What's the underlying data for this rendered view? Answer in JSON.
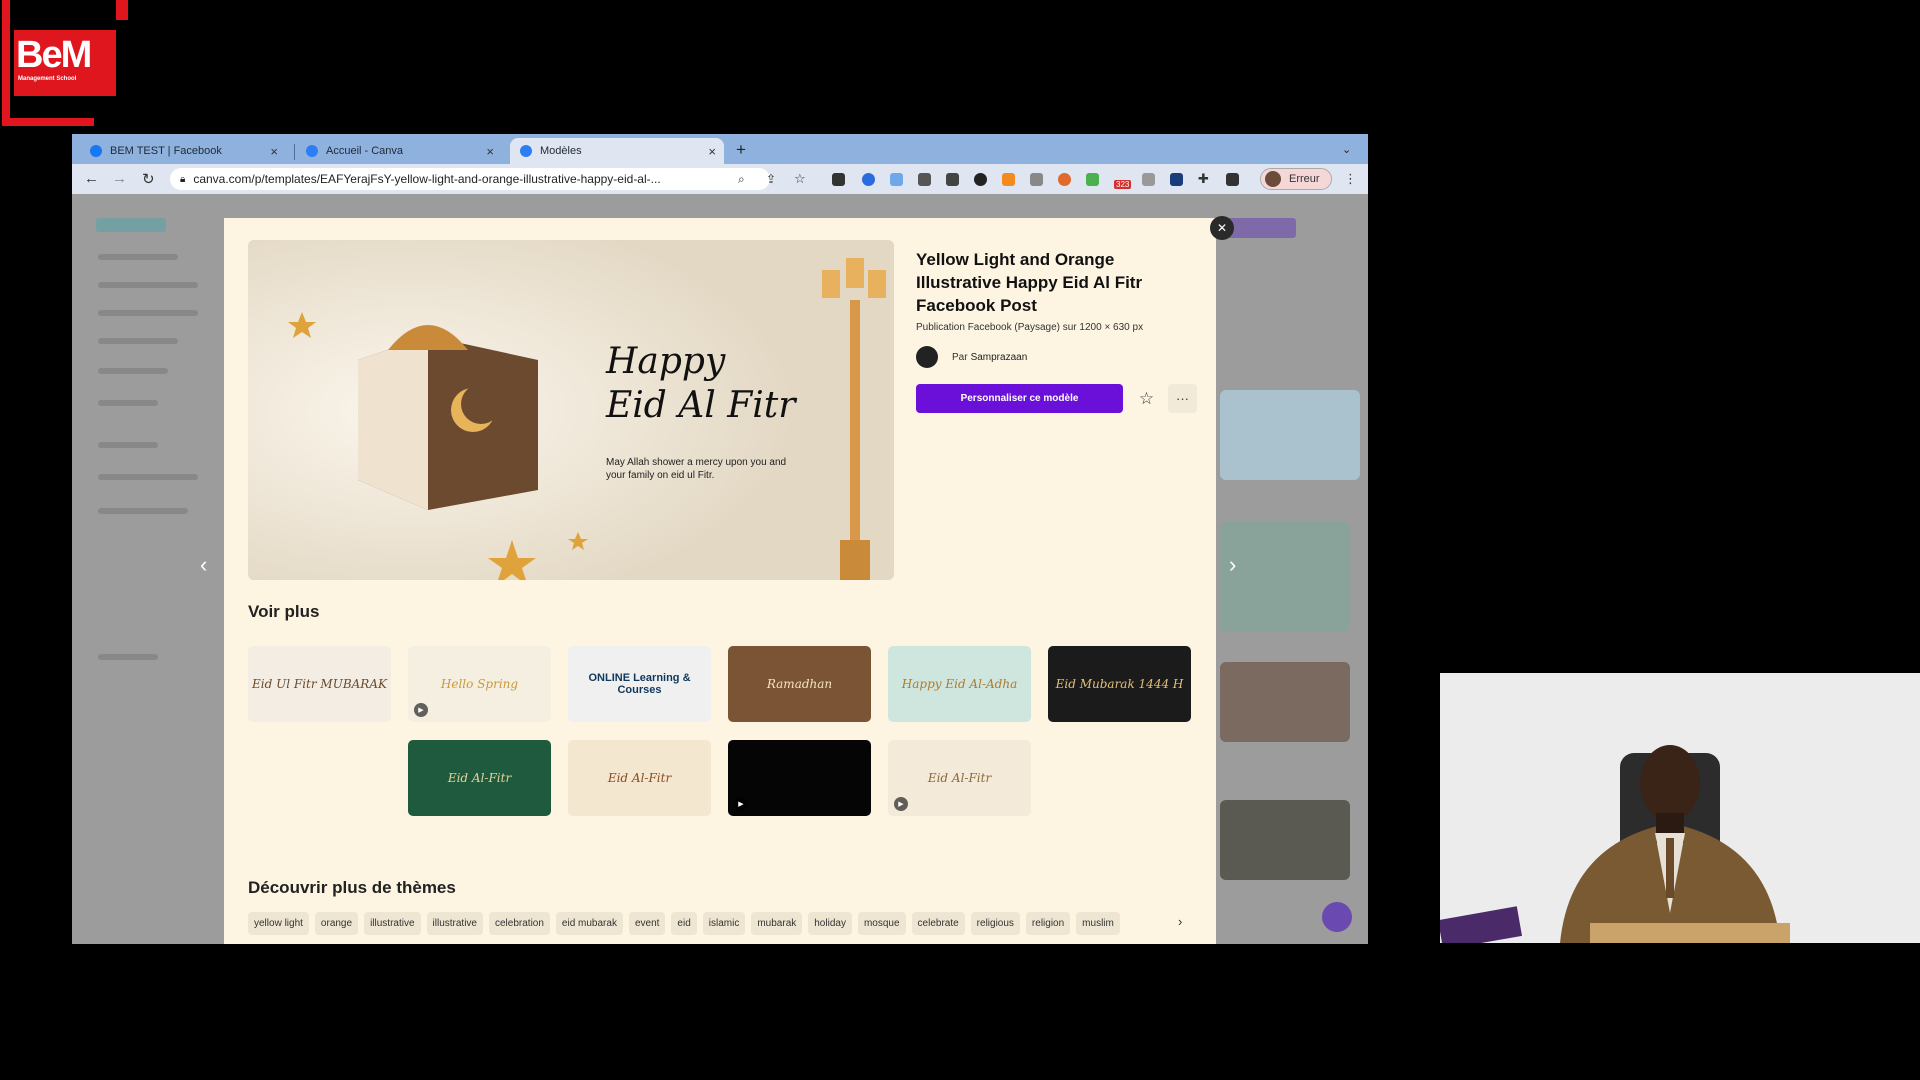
{
  "logo": {
    "text": "BeM",
    "tagline": "Management School"
  },
  "browser": {
    "tabs": [
      {
        "label": "BEM TEST | Facebook",
        "icon": "facebook-icon",
        "color": "#1877f2"
      },
      {
        "label": "Accueil - Canva",
        "icon": "canva-icon",
        "color": "#2c7ef5"
      },
      {
        "label": "Modèles",
        "icon": "canva-icon",
        "color": "#2c7ef5"
      }
    ],
    "url": "canva.com/p/templates/EAFYerajFsY-yellow-light-and-orange-illustrative-happy-eid-al-...",
    "profile_label": "Erreur",
    "badge_count": "323"
  },
  "modal": {
    "title": "Yellow Light and Orange Illustrative Happy Eid Al Fitr Facebook Post",
    "subtitle": "Publication Facebook (Paysage) sur 1200 × 630 px",
    "author_prefix": "Par",
    "author_name": "Samprazaan",
    "cta_label": "Personnaliser ce modèle",
    "preview": {
      "heading_line1": "Happy",
      "heading_line2": "Eid Al Fitr",
      "message": "May Allah shower a mercy upon you and your family on eid ul Fitr."
    },
    "more_title": "Voir plus",
    "thumbs_row1": [
      {
        "text": "Eid Ul Fitr MUBARAK",
        "bg": "#f3ede4",
        "fg": "#6b4a2b",
        "video": false
      },
      {
        "text": "Hello Spring",
        "bg": "#f5efe2",
        "fg": "#c79a3a",
        "video": true
      },
      {
        "text": "ONLINE Learning & Courses",
        "bg": "#f0f0f0",
        "fg": "#10375c",
        "video": false
      },
      {
        "text": "Ramadhan",
        "bg": "#7a5435",
        "fg": "#f6e3c1",
        "video": false
      },
      {
        "text": "Happy Eid Al-Adha",
        "bg": "#cfe6df",
        "fg": "#b07a2e",
        "video": false
      },
      {
        "text": "Eid Mubarak 1444 H",
        "bg": "#1b1b1b",
        "fg": "#e2c07a",
        "video": false
      }
    ],
    "thumbs_row2": [
      {
        "text": "Eid Al-Fitr",
        "bg": "#1f5a3e",
        "fg": "#e6d39a",
        "video": false
      },
      {
        "text": "Eid Al-Fitr",
        "bg": "#f4e7cf",
        "fg": "#8a4b1f",
        "video": false
      },
      {
        "text": "",
        "bg": "#050505",
        "fg": "#e2c07a",
        "video": true
      },
      {
        "text": "Eid Al-Fitr",
        "bg": "#f3ead9",
        "fg": "#8a6a3a",
        "video": true
      }
    ],
    "themes_title": "Découvrir plus de thèmes",
    "chips": [
      "yellow light",
      "orange",
      "illustrative",
      "illustrative",
      "celebration",
      "eid mubarak",
      "event",
      "eid",
      "islamic",
      "mubarak",
      "holiday",
      "mosque",
      "celebrate",
      "religious",
      "religion",
      "muslim"
    ]
  }
}
